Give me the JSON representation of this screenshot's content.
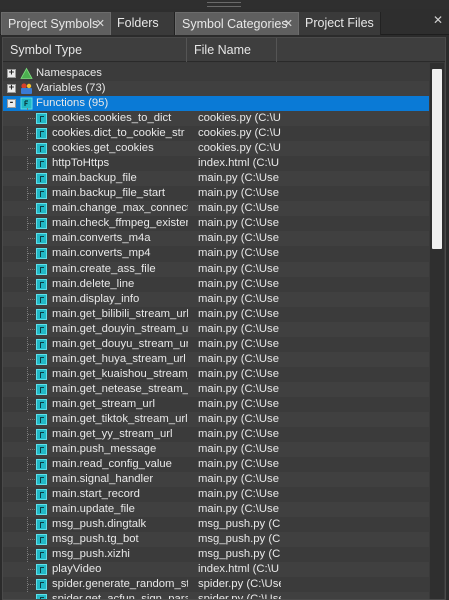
{
  "tabs": [
    {
      "label": "Project Symbols",
      "active": true,
      "closable": true
    },
    {
      "label": "Folders",
      "active": false,
      "closable": false
    },
    {
      "label": "Symbol Categories",
      "active": true,
      "closable": true
    },
    {
      "label": "Project Files",
      "active": false,
      "closable": false
    }
  ],
  "close_glyph": "✕",
  "panel_close_glyph": "✕",
  "columns": {
    "symbol_type": "Symbol Type",
    "file_name": "File Name"
  },
  "categories": [
    {
      "label": "Namespaces",
      "expander": "+",
      "icon": "namespace-icon",
      "color": "#4caf50"
    },
    {
      "label": "Variables (73)",
      "expander": "+",
      "icon": "variable-icon",
      "color": "#3a7bd5"
    },
    {
      "label": "Functions (95)",
      "expander": "-",
      "icon": "function-icon",
      "color": "#22b8c6",
      "selected": true
    }
  ],
  "functions": [
    {
      "name": "cookies.cookies_to_dict",
      "file": "cookies.py (C:\\U"
    },
    {
      "name": "cookies.dict_to_cookie_str",
      "file": "cookies.py (C:\\U"
    },
    {
      "name": "cookies.get_cookies",
      "file": "cookies.py (C:\\U"
    },
    {
      "name": "httpToHttps",
      "file": "index.html (C:\\U"
    },
    {
      "name": "main.backup_file",
      "file": "main.py (C:\\Use"
    },
    {
      "name": "main.backup_file_start",
      "file": "main.py (C:\\Use"
    },
    {
      "name": "main.change_max_connect",
      "file": "main.py (C:\\Use"
    },
    {
      "name": "main.check_ffmpeg_exister",
      "file": "main.py (C:\\Use"
    },
    {
      "name": "main.converts_m4a",
      "file": "main.py (C:\\Use"
    },
    {
      "name": "main.converts_mp4",
      "file": "main.py (C:\\Use"
    },
    {
      "name": "main.create_ass_file",
      "file": "main.py (C:\\Use"
    },
    {
      "name": "main.delete_line",
      "file": "main.py (C:\\Use"
    },
    {
      "name": "main.display_info",
      "file": "main.py (C:\\Use"
    },
    {
      "name": "main.get_bilibili_stream_url",
      "file": "main.py (C:\\Use"
    },
    {
      "name": "main.get_douyin_stream_ur",
      "file": "main.py (C:\\Use"
    },
    {
      "name": "main.get_douyu_stream_url",
      "file": "main.py (C:\\Use"
    },
    {
      "name": "main.get_huya_stream_url",
      "file": "main.py (C:\\Use"
    },
    {
      "name": "main.get_kuaishou_stream_",
      "file": "main.py (C:\\Use"
    },
    {
      "name": "main.get_netease_stream_u",
      "file": "main.py (C:\\Use"
    },
    {
      "name": "main.get_stream_url",
      "file": "main.py (C:\\Use"
    },
    {
      "name": "main.get_tiktok_stream_url",
      "file": "main.py (C:\\Use"
    },
    {
      "name": "main.get_yy_stream_url",
      "file": "main.py (C:\\Use"
    },
    {
      "name": "main.push_message",
      "file": "main.py (C:\\Use"
    },
    {
      "name": "main.read_config_value",
      "file": "main.py (C:\\Use"
    },
    {
      "name": "main.signal_handler",
      "file": "main.py (C:\\Use"
    },
    {
      "name": "main.start_record",
      "file": "main.py (C:\\Use"
    },
    {
      "name": "main.update_file",
      "file": "main.py (C:\\Use"
    },
    {
      "name": "msg_push.dingtalk",
      "file": "msg_push.py (C"
    },
    {
      "name": "msg_push.tg_bot",
      "file": "msg_push.py (C"
    },
    {
      "name": "msg_push.xizhi",
      "file": "msg_push.py (C"
    },
    {
      "name": "playVideo",
      "file": "index.html (C:\\U"
    },
    {
      "name": "spider.generate_random_str",
      "file": "spider.py (C:\\Use"
    },
    {
      "name": "spider.get_acfun_sign_para",
      "file": "spider.py (C:\\Use"
    }
  ]
}
